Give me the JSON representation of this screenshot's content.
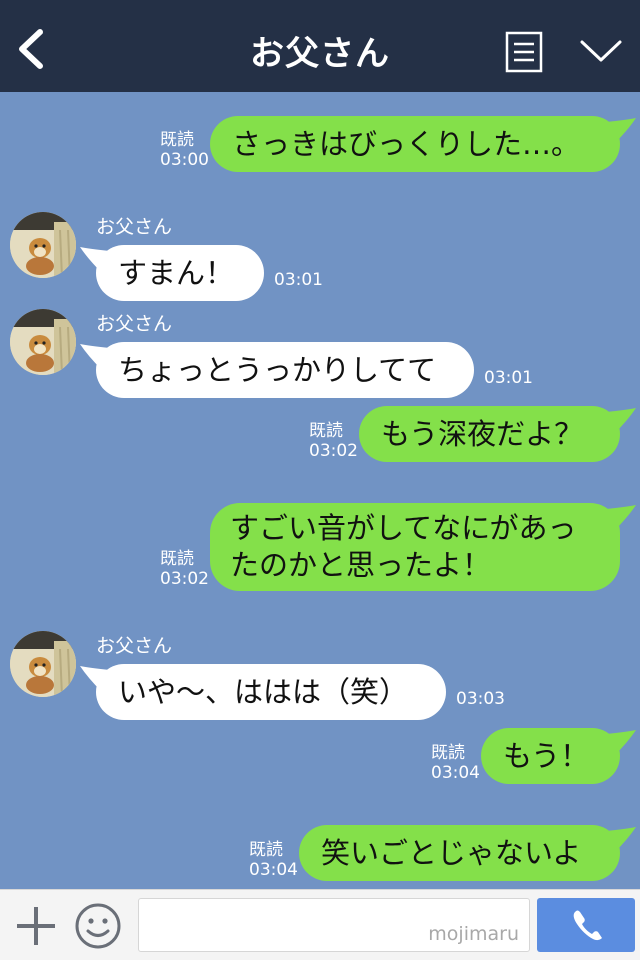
{
  "header": {
    "title": "お父さん",
    "back_icon": "chevron-left-icon",
    "menu_icon": "list-icon",
    "expand_icon": "chevron-down-icon"
  },
  "messages": [
    {
      "side": "out",
      "text": "さっきはびっくりした…。",
      "read": "既読",
      "time": "03:00"
    },
    {
      "side": "in",
      "sender": "お父さん",
      "text": "すまん！",
      "time": "03:01"
    },
    {
      "side": "in",
      "sender": "お父さん",
      "text": "ちょっとうっかりしてて",
      "time": "03:01"
    },
    {
      "side": "out",
      "text": "もう深夜だよ？",
      "read": "既読",
      "time": "03:02"
    },
    {
      "side": "out",
      "text": "すごい音がしてなにがあったのかと思ったよ！",
      "read": "既読",
      "time": "03:02"
    },
    {
      "side": "in",
      "sender": "お父さん",
      "text": "いや〜、ははは（笑）",
      "time": "03:03"
    },
    {
      "side": "out",
      "text": "もう！",
      "read": "既読",
      "time": "03:04"
    },
    {
      "side": "out",
      "text": "笑いごとじゃないよ",
      "read": "既読",
      "time": "03:04"
    }
  ],
  "input": {
    "value": "",
    "watermark": "mojimaru"
  },
  "colors": {
    "background": "#7193c4",
    "header": "#243046",
    "outgoing_bubble": "#84e04a",
    "incoming_bubble": "#ffffff",
    "send_button": "#5b8de0"
  }
}
